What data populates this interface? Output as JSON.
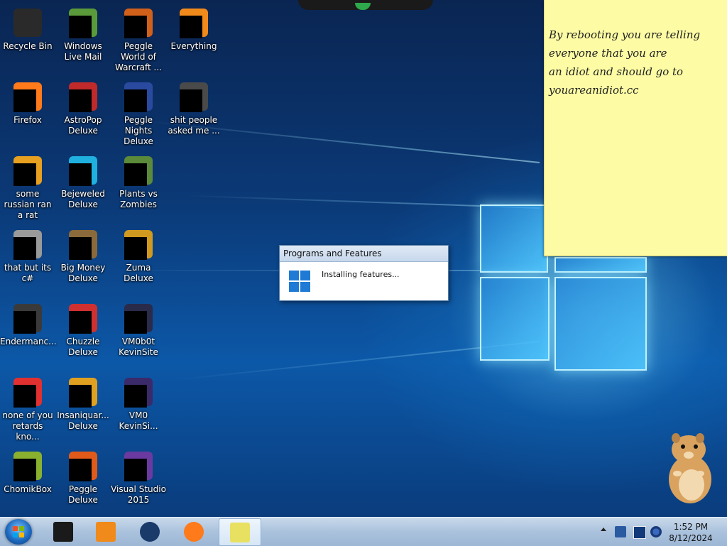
{
  "desktop_icons": [
    {
      "label": "Recycle Bin",
      "color": "#2a2a2a"
    },
    {
      "label": "Windows Live Mail",
      "color": "#5a9a3a"
    },
    {
      "label": "Peggle World of Warcraft ...",
      "color": "#d0601a"
    },
    {
      "label": "Everything",
      "color": "#f08a1a"
    },
    {
      "label": "Firefox",
      "color": "#ff7a1a"
    },
    {
      "label": "AstroPop Deluxe",
      "color": "#c02a2a"
    },
    {
      "label": "Peggle Nights Deluxe",
      "color": "#2a4aa0"
    },
    {
      "label": "shit people asked me ...",
      "color": "#4a4a4a"
    },
    {
      "label": "some russian ran a rat",
      "color": "#e8a020"
    },
    {
      "label": "Bejeweled Deluxe",
      "color": "#20b0e0"
    },
    {
      "label": "Plants vs Zombies",
      "color": "#5a8a3a"
    },
    {
      "label": "that but its c#",
      "color": "#9a9a9a"
    },
    {
      "label": "Big Money Deluxe",
      "color": "#8a6a3a"
    },
    {
      "label": "Zuma Deluxe",
      "color": "#d09a20"
    },
    {
      "label": "Endermanc...",
      "color": "#3a3a3a"
    },
    {
      "label": "Chuzzle Deluxe",
      "color": "#d03030"
    },
    {
      "label": "VM0b0t KevinSite",
      "color": "#2a2a4a"
    },
    {
      "label": "none of you retards kno...",
      "color": "#e03030"
    },
    {
      "label": "Insaniquar... Deluxe",
      "color": "#e0a020"
    },
    {
      "label": "VM0 KevinSi...",
      "color": "#3a2a6a"
    },
    {
      "label": "ChomikBox",
      "color": "#8ab030"
    },
    {
      "label": "Peggle Deluxe",
      "color": "#e05a1a"
    },
    {
      "label": "Visual Studio 2015",
      "color": "#6a3aa0"
    }
  ],
  "sticky_note": {
    "text": "By rebooting you are telling\neveryone that you are\nan idiot and should go to\nyouareanidiot.cc"
  },
  "dialog": {
    "title": "Programs and Features",
    "message": "Installing features..."
  },
  "taskbar": {
    "items": [
      {
        "name": "terminal-taskbar-icon",
        "color": "#1a1a1a"
      },
      {
        "name": "media-player-taskbar-icon",
        "color": "#f08a1a"
      },
      {
        "name": "globe-taskbar-icon",
        "color": "#1a3a6a"
      },
      {
        "name": "firefox-taskbar-icon",
        "color": "#ff7a1a"
      },
      {
        "name": "sticky-notes-taskbar-icon",
        "color": "#e8e060"
      }
    ]
  },
  "clock": {
    "time": "1:52 PM",
    "date": "8/12/2024"
  },
  "colors": {
    "accent": "#1e7ad4",
    "sticky": "#fdfca4"
  }
}
